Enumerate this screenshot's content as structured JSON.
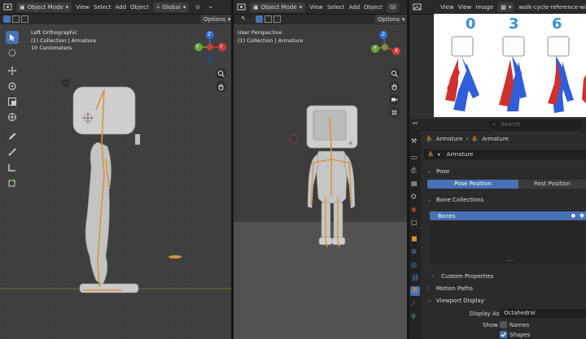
{
  "left_viewport": {
    "mode": "Object Mode",
    "menus": [
      "View",
      "Select",
      "Add",
      "Object"
    ],
    "transform": "Global",
    "options": "Options",
    "view_name": "Left Orthographic",
    "collection": "(1) Collection | Armature",
    "scale": "10 Centimeters",
    "gizmo": {
      "top": "Z",
      "right": "Y",
      "left": "Y"
    }
  },
  "right_viewport": {
    "mode": "Object Mode",
    "menus": [
      "View",
      "Select",
      "Add",
      "Object"
    ],
    "transform": "Gl",
    "options": "Options",
    "view_name": "User Perspective",
    "collection": "(1) Collection | Armature",
    "gizmo": {
      "top": "Z",
      "right": "X",
      "left": "Y"
    }
  },
  "image_editor": {
    "menus": [
      "View",
      "View",
      "Image"
    ],
    "filename": "walk-cycle-reference-wi",
    "frame_numbers": [
      "0",
      "3",
      "6"
    ]
  },
  "properties": {
    "search_placeholder": "Search",
    "breadcrumb_1": "Armature",
    "breadcrumb_2": "Armature",
    "data_name": "Armature",
    "pose_panel": "Pose",
    "pose_position": "Pose Position",
    "rest_position": "Rest Position",
    "bone_collections_panel": "Bone Collections",
    "bone_collection_item": "Bones",
    "custom_properties": "Custom Properties",
    "motion_paths": "Motion Paths",
    "viewport_display": "Viewport Display",
    "display_as_label": "Display As",
    "display_as_value": "Octahedral",
    "show_label": "Show",
    "names_label": "Names",
    "shapes_label": "Shapes",
    "shapes_checked": true,
    "names_checked": false
  },
  "colors": {
    "accent": "#4772b3",
    "bone": "#d7943f",
    "body": "#c9c9c9",
    "figure_red": "#d0312d",
    "figure_blue": "#2f5ed8",
    "frame_num": "#3a8fd6"
  }
}
